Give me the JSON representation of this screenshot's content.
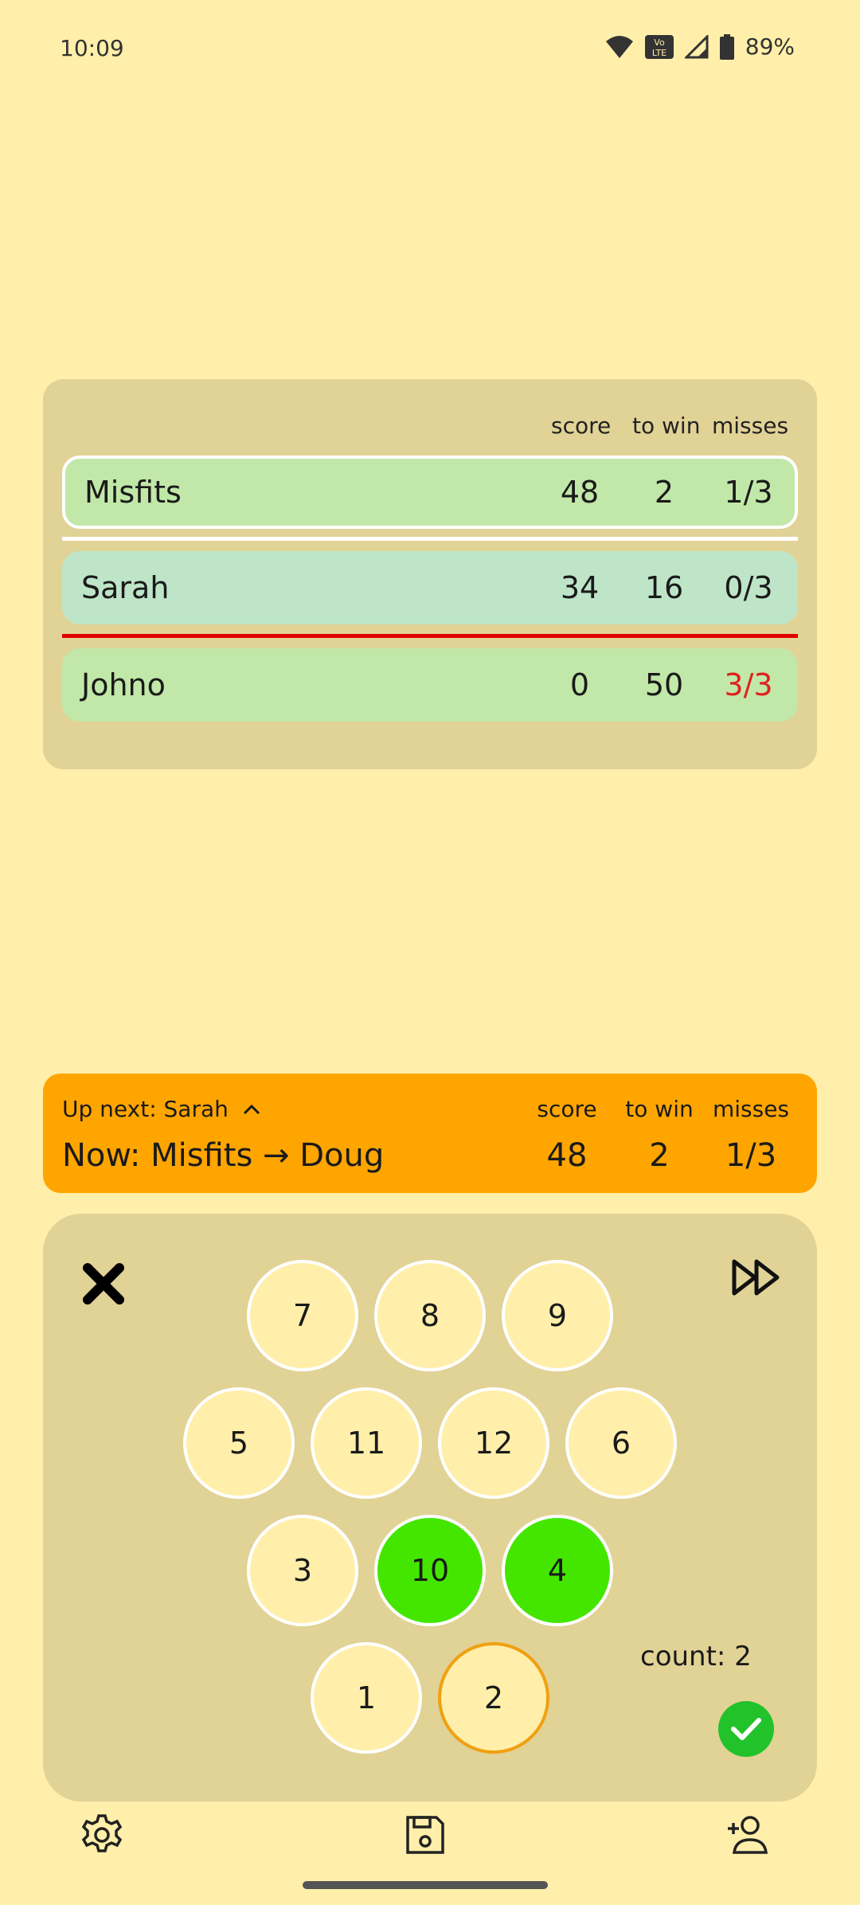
{
  "status_bar": {
    "time": "10:09",
    "battery": "89%",
    "volte_label": "Vo LTE"
  },
  "scoreboard": {
    "headers": {
      "score": "score",
      "to_win": "to win",
      "misses": "misses"
    },
    "rows": [
      {
        "name": "Misfits",
        "score": "48",
        "to_win": "2",
        "misses": "1/3"
      },
      {
        "name": "Sarah",
        "score": "34",
        "to_win": "16",
        "misses": "0/3"
      },
      {
        "name": "Johno",
        "score": "0",
        "to_win": "50",
        "misses": "3/3"
      }
    ]
  },
  "current": {
    "up_next": "Up next: Sarah",
    "now": "Now: Misfits → Doug",
    "headers": {
      "score": "score",
      "to_win": "to win",
      "misses": "misses"
    },
    "score": "48",
    "to_win": "2",
    "misses": "1/3"
  },
  "keypad": {
    "pins": [
      "7",
      "8",
      "9",
      "5",
      "11",
      "12",
      "6",
      "3",
      "10",
      "4",
      "1",
      "2"
    ],
    "selected": [
      "10",
      "4"
    ],
    "count_label": "count: 2"
  },
  "colors": {
    "background": "#FFEFAA",
    "panel": "#E1D296",
    "banner": "#FFA500",
    "selected_pin": "#44E600",
    "confirm": "#22C32A",
    "miss_warning": "#E02020"
  },
  "icons": {
    "close": "close-icon",
    "fast_forward": "fast-forward-icon",
    "confirm": "check-icon",
    "settings": "gear-icon",
    "save": "save-icon",
    "add_player": "add-person-icon",
    "expand": "chevron-up-icon"
  }
}
